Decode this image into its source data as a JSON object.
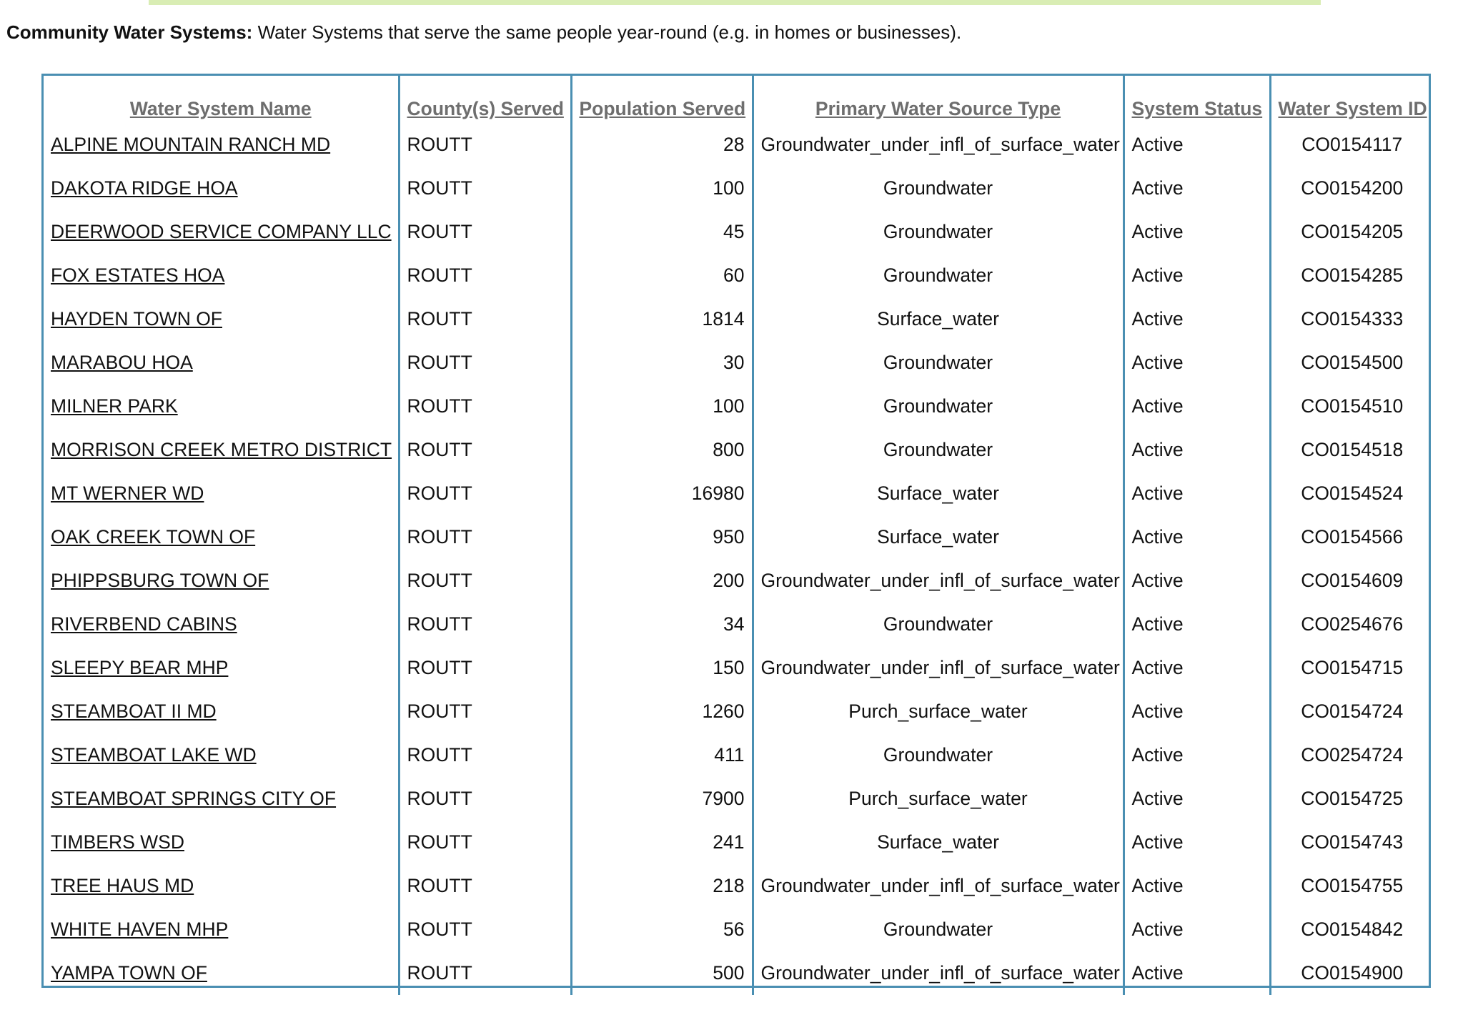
{
  "intro": {
    "label": "Community Water Systems:",
    "text": " Water Systems that serve the same people year-round (e.g. in homes or businesses)."
  },
  "table": {
    "headers": [
      "Water System Name",
      "County(s) Served",
      "Population Served",
      "Primary Water Source Type",
      "System Status",
      "Water System ID"
    ],
    "rows": [
      {
        "name": "ALPINE MOUNTAIN RANCH MD",
        "county": "ROUTT",
        "population": "28",
        "source": "Groundwater_under_infl_of_surface_water",
        "status": "Active",
        "id": "CO0154117"
      },
      {
        "name": "DAKOTA RIDGE HOA",
        "county": "ROUTT",
        "population": "100",
        "source": "Groundwater",
        "status": "Active",
        "id": "CO0154200"
      },
      {
        "name": "DEERWOOD SERVICE COMPANY LLC",
        "county": "ROUTT",
        "population": "45",
        "source": "Groundwater",
        "status": "Active",
        "id": "CO0154205"
      },
      {
        "name": "FOX ESTATES HOA",
        "county": "ROUTT",
        "population": "60",
        "source": "Groundwater",
        "status": "Active",
        "id": "CO0154285"
      },
      {
        "name": "HAYDEN TOWN OF",
        "county": "ROUTT",
        "population": "1814",
        "source": "Surface_water",
        "status": "Active",
        "id": "CO0154333"
      },
      {
        "name": "MARABOU HOA",
        "county": "ROUTT",
        "population": "30",
        "source": "Groundwater",
        "status": "Active",
        "id": "CO0154500"
      },
      {
        "name": "MILNER PARK",
        "county": "ROUTT",
        "population": "100",
        "source": "Groundwater",
        "status": "Active",
        "id": "CO0154510"
      },
      {
        "name": "MORRISON CREEK METRO DISTRICT",
        "county": "ROUTT",
        "population": "800",
        "source": "Groundwater",
        "status": "Active",
        "id": "CO0154518"
      },
      {
        "name": "MT WERNER WD",
        "county": "ROUTT",
        "population": "16980",
        "source": "Surface_water",
        "status": "Active",
        "id": "CO0154524"
      },
      {
        "name": "OAK CREEK TOWN OF",
        "county": "ROUTT",
        "population": "950",
        "source": "Surface_water",
        "status": "Active",
        "id": "CO0154566"
      },
      {
        "name": "PHIPPSBURG TOWN OF",
        "county": "ROUTT",
        "population": "200",
        "source": "Groundwater_under_infl_of_surface_water",
        "status": "Active",
        "id": "CO0154609"
      },
      {
        "name": "RIVERBEND CABINS",
        "county": "ROUTT",
        "population": "34",
        "source": "Groundwater",
        "status": "Active",
        "id": "CO0254676"
      },
      {
        "name": "SLEEPY BEAR MHP",
        "county": "ROUTT",
        "population": "150",
        "source": "Groundwater_under_infl_of_surface_water",
        "status": "Active",
        "id": "CO0154715"
      },
      {
        "name": "STEAMBOAT II MD",
        "county": "ROUTT",
        "population": "1260",
        "source": "Purch_surface_water",
        "status": "Active",
        "id": "CO0154724"
      },
      {
        "name": "STEAMBOAT LAKE WD",
        "county": "ROUTT",
        "population": "411",
        "source": "Groundwater",
        "status": "Active",
        "id": "CO0254724"
      },
      {
        "name": "STEAMBOAT SPRINGS CITY OF",
        "county": "ROUTT",
        "population": "7900",
        "source": "Purch_surface_water",
        "status": "Active",
        "id": "CO0154725"
      },
      {
        "name": "TIMBERS WSD",
        "county": "ROUTT",
        "population": "241",
        "source": "Surface_water",
        "status": "Active",
        "id": "CO0154743"
      },
      {
        "name": "TREE HAUS MD",
        "county": "ROUTT",
        "population": "218",
        "source": "Groundwater_under_infl_of_surface_water",
        "status": "Active",
        "id": "CO0154755"
      },
      {
        "name": "WHITE HAVEN MHP",
        "county": "ROUTT",
        "population": "56",
        "source": "Groundwater",
        "status": "Active",
        "id": "CO0154842"
      },
      {
        "name": "YAMPA TOWN OF",
        "county": "ROUTT",
        "population": "500",
        "source": "Groundwater_under_infl_of_surface_water",
        "status": "Active",
        "id": "CO0154900"
      }
    ]
  },
  "colors": {
    "table_border": "#4a8fb2",
    "header_text": "#6e6e6e",
    "top_rule": "#d9edb4"
  }
}
